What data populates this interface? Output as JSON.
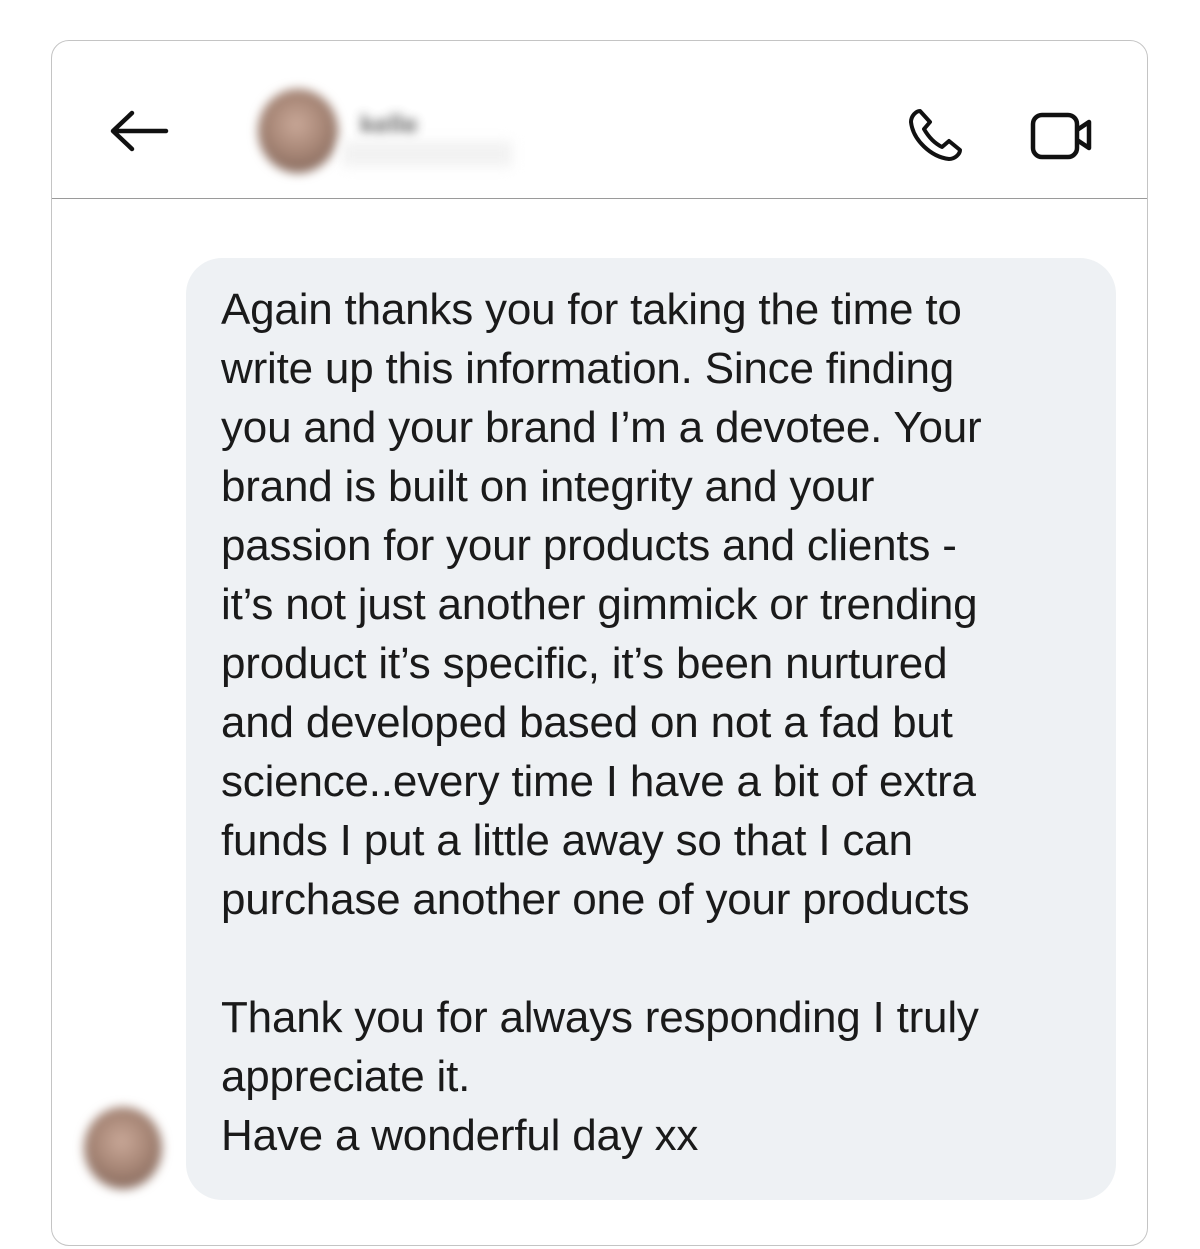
{
  "header": {
    "back_icon": "arrow-left-icon",
    "contact_name": "kelle",
    "call_icon": "phone-icon",
    "video_icon": "video-camera-icon"
  },
  "message": {
    "paragraph_1": "Again thanks you for taking the time to\nwrite up this information. Since finding\nyou and your brand I’m a devotee. Your\nbrand is built on integrity and your\npassion for your products and clients -\nit’s not just another gimmick or trending\nproduct it’s specific, it’s been nurtured\nand developed based on not a fad but\nscience..every time I have a bit of extra\nfunds I put a little away so that I can\npurchase another one of your products",
    "paragraph_2": "Thank you for always responding I truly\nappreciate it.\nHave a wonderful day xx"
  },
  "colors": {
    "bubble_background": "#eef1f4",
    "text": "#1a1a1a",
    "border": "#c4c4c4"
  }
}
